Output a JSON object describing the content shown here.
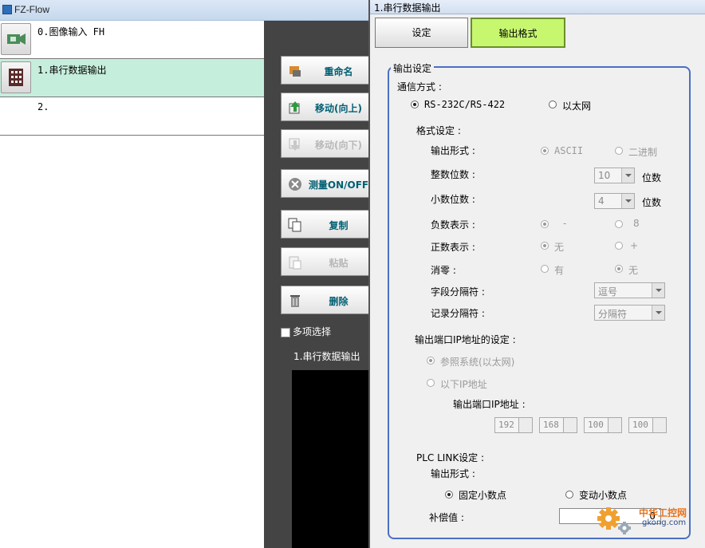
{
  "left_window": {
    "title": "FZ-Flow",
    "flow_items": [
      {
        "label": "0.图像输入 FH"
      },
      {
        "label": "1.串行数据输出"
      },
      {
        "label": "2."
      }
    ],
    "side_buttons": [
      {
        "label": "重命名",
        "icon": "rename-icon",
        "enabled": true
      },
      {
        "label": "移动(向上)",
        "icon": "move-up-icon",
        "enabled": true
      },
      {
        "label": "移动(向下)",
        "icon": "move-down-icon",
        "enabled": false
      },
      {
        "label": "测量ON/OFF",
        "icon": "measure-toggle-icon",
        "enabled": true
      },
      {
        "label": "复制",
        "icon": "copy-icon",
        "enabled": true
      },
      {
        "label": "粘贴",
        "icon": "paste-icon",
        "enabled": false
      },
      {
        "label": "删除",
        "icon": "delete-icon",
        "enabled": true
      }
    ],
    "multi_select_label": "多项选择",
    "selected_name": "1.串行数据输出"
  },
  "dialog": {
    "title": "1.串行数据输出",
    "tabs": [
      {
        "label": "设定",
        "active": false
      },
      {
        "label": "输出格式",
        "active": true
      }
    ],
    "output_settings": {
      "legend": "输出设定",
      "comm_method_label": "通信方式 :",
      "comm_options": [
        "RS-232C/RS-422",
        "以太网"
      ],
      "comm_selected": "RS-232C/RS-422",
      "format_label": "格式设定 :",
      "output_form_label": "输出形式 :",
      "output_form_options": [
        "ASCII",
        "二进制"
      ],
      "int_digits_label": "整数位数 :",
      "int_digits_value": "10",
      "digits_unit": "位数",
      "dec_digits_label": "小数位数 :",
      "dec_digits_value": "4",
      "neg_label": "负数表示 :",
      "neg_options": [
        "-",
        "8"
      ],
      "pos_label": "正数表示 :",
      "pos_options": [
        "无",
        "+"
      ],
      "zero_label": "消零 :",
      "zero_options": [
        "有",
        "无"
      ],
      "field_sep_label": "字段分隔符 :",
      "field_sep_value": "逗号",
      "record_sep_label": "记录分隔符 :",
      "record_sep_value": "分隔符",
      "ip_setting_label": "输出端口IP地址的设定 :",
      "ip_options": [
        "参照系统(以太网)",
        "以下IP地址"
      ],
      "ip_address_label": "输出端口IP地址 :",
      "ip_octets": [
        "192",
        "168",
        "100",
        "100"
      ],
      "plc_label": "PLC LINK设定 :",
      "plc_output_form_label": "输出形式 :",
      "plc_options": [
        "固定小数点",
        "变动小数点"
      ],
      "compensation_label": "补偿值 :",
      "compensation_value": "0"
    }
  },
  "watermark": {
    "line1": "中华工控网",
    "line2": "gkong.com",
    "color": "#e8741c"
  }
}
